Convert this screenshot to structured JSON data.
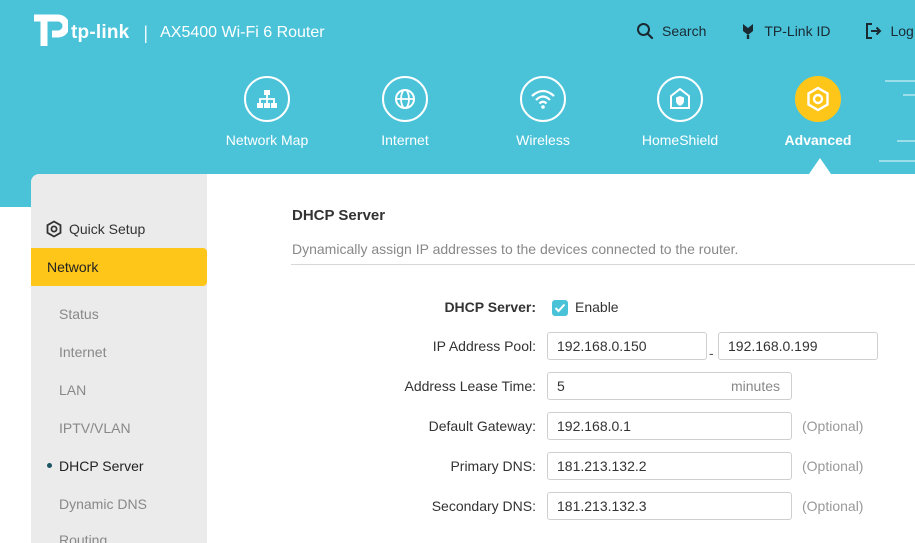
{
  "brand": {
    "logo_text": "tp-link",
    "separator": "|",
    "model": "AX5400 Wi-Fi 6 Router"
  },
  "toplinks": [
    {
      "label": "Search",
      "icon": "search-icon"
    },
    {
      "label": "TP-Link ID",
      "icon": "tplink-id-icon"
    },
    {
      "label": "Log",
      "icon": "logout-icon"
    }
  ],
  "nav": [
    {
      "label": "Network Map",
      "icon": "network-map-icon",
      "active": false
    },
    {
      "label": "Internet",
      "icon": "globe-icon",
      "active": false
    },
    {
      "label": "Wireless",
      "icon": "wifi-icon",
      "active": false
    },
    {
      "label": "HomeShield",
      "icon": "homeshield-icon",
      "active": false
    },
    {
      "label": "Advanced",
      "icon": "gear-icon",
      "active": true
    }
  ],
  "sidebar": {
    "quick_setup": "Quick Setup",
    "section": "Network",
    "items": [
      "Status",
      "Internet",
      "LAN",
      "IPTV/VLAN",
      "DHCP Server",
      "Dynamic DNS",
      "Routing"
    ],
    "active_item": "DHCP Server"
  },
  "form": {
    "title": "DHCP Server",
    "description": "Dynamically assign IP addresses to the devices connected to the router.",
    "dhcp_label": "DHCP Server:",
    "enable_label": "Enable",
    "pool_label": "IP Address Pool:",
    "pool_start": "192.168.0.150",
    "pool_dash": "-",
    "pool_end": "192.168.0.199",
    "lease_label": "Address Lease Time:",
    "lease_value": "5",
    "lease_unit": "minutes",
    "gateway_label": "Default Gateway:",
    "gateway_value": "192.168.0.1",
    "primary_dns_label": "Primary DNS:",
    "primary_dns_value": "181.213.132.2",
    "secondary_dns_label": "Secondary DNS:",
    "secondary_dns_value": "181.213.132.3",
    "optional": "(Optional)"
  },
  "colors": {
    "header": "#4ac3d9",
    "accent": "#ffc61a",
    "sidebar": "#ebebeb"
  }
}
